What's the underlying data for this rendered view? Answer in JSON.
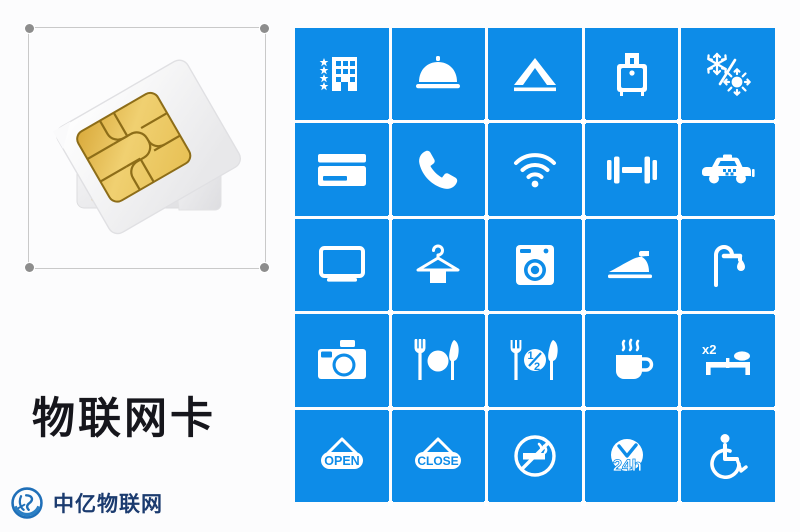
{
  "product": {
    "title": "物联网卡",
    "image_alt": "sim-card-photo",
    "selection_handles": 4
  },
  "brand": {
    "name": "中亿物联网",
    "mark": "zhongyi-logo-icon",
    "color": "#1b3b6f"
  },
  "theme": {
    "tile_blue": "#0d8ce8",
    "tile_gap": "#ffffff",
    "page_background": "#fdfdfe",
    "title_color": "#16161c",
    "handle_color": "#8d8d8d"
  },
  "icon_grid": {
    "columns": 5,
    "rows": 5,
    "count": 25,
    "tiles": [
      {
        "row": 1,
        "col": 1,
        "icon": "hotel-stars-icon",
        "label": "Star Hotel"
      },
      {
        "row": 1,
        "col": 2,
        "icon": "room-service-bell-icon",
        "label": "Room Service"
      },
      {
        "row": 1,
        "col": 3,
        "icon": "tent-camping-icon",
        "label": "Camping"
      },
      {
        "row": 1,
        "col": 4,
        "icon": "luggage-icon",
        "label": "Luggage Storage"
      },
      {
        "row": 1,
        "col": 5,
        "icon": "air-conditioning-icon",
        "label": "Air Conditioning"
      },
      {
        "row": 2,
        "col": 1,
        "icon": "credit-card-icon",
        "label": "Card Payment"
      },
      {
        "row": 2,
        "col": 2,
        "icon": "telephone-icon",
        "label": "Telephone"
      },
      {
        "row": 2,
        "col": 3,
        "icon": "wifi-icon",
        "label": "Wi-Fi"
      },
      {
        "row": 2,
        "col": 4,
        "icon": "dumbbell-icon",
        "label": "Gym"
      },
      {
        "row": 2,
        "col": 5,
        "icon": "taxi-icon",
        "label": "Taxi"
      },
      {
        "row": 3,
        "col": 1,
        "icon": "television-icon",
        "label": "TV"
      },
      {
        "row": 3,
        "col": 2,
        "icon": "clothes-hanger-icon",
        "label": "Laundry"
      },
      {
        "row": 3,
        "col": 3,
        "icon": "washing-machine-icon",
        "label": "Washing Machine"
      },
      {
        "row": 3,
        "col": 4,
        "icon": "iron-icon",
        "label": "Ironing"
      },
      {
        "row": 3,
        "col": 5,
        "icon": "shower-icon",
        "label": "Shower"
      },
      {
        "row": 4,
        "col": 1,
        "icon": "camera-icon",
        "label": "Camera"
      },
      {
        "row": 4,
        "col": 2,
        "icon": "restaurant-icon",
        "label": "Restaurant"
      },
      {
        "row": 4,
        "col": 3,
        "icon": "half-board-icon",
        "label": "Half Board",
        "badge": "1/2"
      },
      {
        "row": 4,
        "col": 4,
        "icon": "coffee-cup-icon",
        "label": "Coffee"
      },
      {
        "row": 4,
        "col": 5,
        "icon": "double-bed-icon",
        "label": "Double Bed",
        "badge": "x2"
      },
      {
        "row": 5,
        "col": 1,
        "icon": "open-sign-icon",
        "label": "Open",
        "badge": "OPEN"
      },
      {
        "row": 5,
        "col": 2,
        "icon": "close-sign-icon",
        "label": "Close",
        "badge": "CLOSE"
      },
      {
        "row": 5,
        "col": 3,
        "icon": "no-smoking-icon",
        "label": "No Smoking"
      },
      {
        "row": 5,
        "col": 4,
        "icon": "clock-24h-icon",
        "label": "24 Hours",
        "badge": "24h"
      },
      {
        "row": 5,
        "col": 5,
        "icon": "wheelchair-access-icon",
        "label": "Accessible"
      }
    ]
  }
}
